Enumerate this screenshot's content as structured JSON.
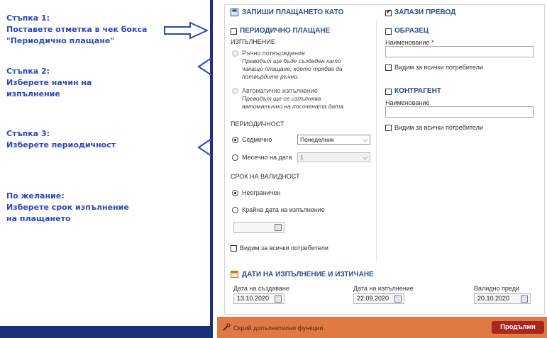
{
  "guide": {
    "step1": {
      "title": "Стъпка 1:",
      "line1": "Поставете отметка в чек бокса",
      "line2": "\"Периодично плащане\""
    },
    "step2": {
      "title": "Стъпка 2:",
      "line1": "Изберете начин на",
      "line2": "изпълнение"
    },
    "step3": {
      "title": "Стъпка 3:",
      "line1": "Изберете периодичност"
    },
    "optional": {
      "title": "По желание:",
      "line1": "Изберете срок изпълнение",
      "line2": "на плащането"
    }
  },
  "save_payment": {
    "title": "ЗАПИШИ ПЛАЩАНЕТО КАТО",
    "periodic_label": "ПЕРИОДИЧНО ПЛАЩАНЕ",
    "execution_label": "ИЗПЪЛНЕНИЕ",
    "manual_label": "Ръчно потвърждение",
    "manual_desc1": "Преводът ще бъде създаден като",
    "manual_desc2": "чакащо плащане, което трябва да",
    "manual_desc3": "потвърдите ръчно.",
    "auto_label": "Автоматично изпълнение",
    "auto_desc1": "Преводът ще се изпълнява",
    "auto_desc2": "автоматично на посочената дата.",
    "periodicity_label": "ПЕРИОДИЧНОСТ",
    "weekly_label": "Седмично",
    "weekly_value": "Понеделник",
    "monthly_label": "Месечно на дата",
    "monthly_value": "1",
    "validity_label": "СРОК НА ВАЛИДНОСТ",
    "unlimited_label": "Неограничен",
    "end_date_label": "Крайна дата на изпълнение",
    "visible_all_label": "Видим за всички потребители"
  },
  "save_transfer": {
    "title": "ЗАПАЗИ ПРЕВОД",
    "template_label": "ОБРАЗЕЦ",
    "name_label": "Наименование *",
    "visible_all_label": "Видим за всички потребители",
    "counterparty_label": "КОНТРАГЕНТ",
    "cp_name_label": "Наименование",
    "cp_visible_all_label": "Видим за всички потребители"
  },
  "dates": {
    "title": "ДАТИ НА ИЗПЪЛНЕНИЕ И ИЗТИЧАНЕ",
    "created_label": "Дата на създаване",
    "created_value": "13.10.2020",
    "execution_label": "Дата на изпълнение",
    "execution_value": "22.09.2020",
    "valid_label": "Валидно преди",
    "valid_value": "20.10.2020"
  },
  "footer": {
    "hide_label": "Скрий допълнителни функции",
    "continue_label": "Продължи"
  },
  "colors": {
    "accent": "#2a4d8f",
    "bar": "#e07a45",
    "button": "#a8271f",
    "guide_text": "#2d47b8"
  }
}
